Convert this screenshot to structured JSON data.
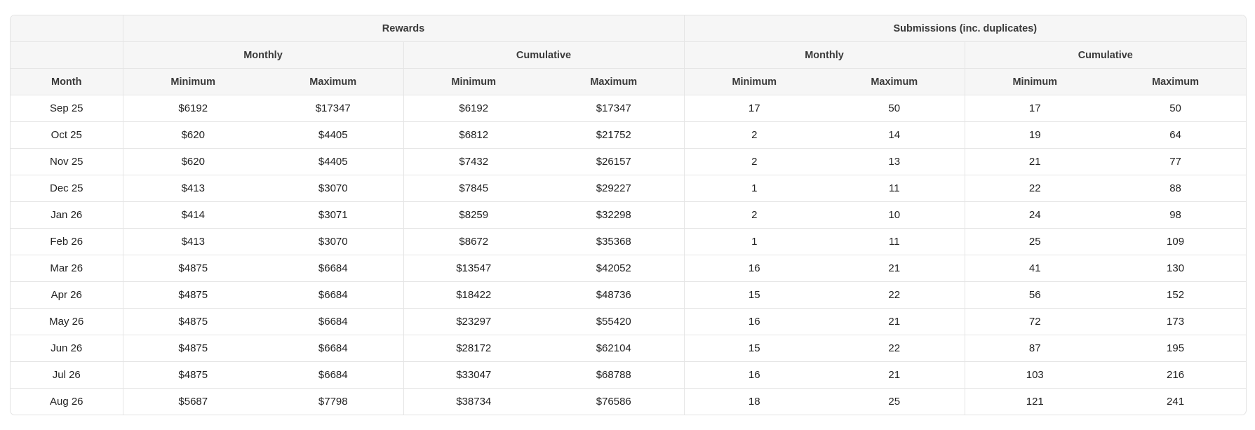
{
  "table": {
    "group_headers": {
      "rewards": "Rewards",
      "submissions": "Submissions (inc. duplicates)"
    },
    "sub_headers": {
      "rewards_monthly": "Monthly",
      "rewards_cumulative": "Cumulative",
      "submissions_monthly": "Monthly",
      "submissions_cumulative": "Cumulative"
    },
    "column_headers": [
      "Month",
      "Minimum",
      "Maximum",
      "Minimum",
      "Maximum",
      "Minimum",
      "Maximum",
      "Minimum",
      "Maximum"
    ],
    "rows": [
      [
        "Sep 25",
        "$6192",
        "$17347",
        "$6192",
        "$17347",
        "17",
        "50",
        "17",
        "50"
      ],
      [
        "Oct 25",
        "$620",
        "$4405",
        "$6812",
        "$21752",
        "2",
        "14",
        "19",
        "64"
      ],
      [
        "Nov 25",
        "$620",
        "$4405",
        "$7432",
        "$26157",
        "2",
        "13",
        "21",
        "77"
      ],
      [
        "Dec 25",
        "$413",
        "$3070",
        "$7845",
        "$29227",
        "1",
        "11",
        "22",
        "88"
      ],
      [
        "Jan 26",
        "$414",
        "$3071",
        "$8259",
        "$32298",
        "2",
        "10",
        "24",
        "98"
      ],
      [
        "Feb 26",
        "$413",
        "$3070",
        "$8672",
        "$35368",
        "1",
        "11",
        "25",
        "109"
      ],
      [
        "Mar 26",
        "$4875",
        "$6684",
        "$13547",
        "$42052",
        "16",
        "21",
        "41",
        "130"
      ],
      [
        "Apr 26",
        "$4875",
        "$6684",
        "$18422",
        "$48736",
        "15",
        "22",
        "56",
        "152"
      ],
      [
        "May 26",
        "$4875",
        "$6684",
        "$23297",
        "$55420",
        "16",
        "21",
        "72",
        "173"
      ],
      [
        "Jun 26",
        "$4875",
        "$6684",
        "$28172",
        "$62104",
        "15",
        "22",
        "87",
        "195"
      ],
      [
        "Jul 26",
        "$4875",
        "$6684",
        "$33047",
        "$68788",
        "16",
        "21",
        "103",
        "216"
      ],
      [
        "Aug 26",
        "$5687",
        "$7798",
        "$38734",
        "$76586",
        "18",
        "25",
        "121",
        "241"
      ]
    ]
  }
}
